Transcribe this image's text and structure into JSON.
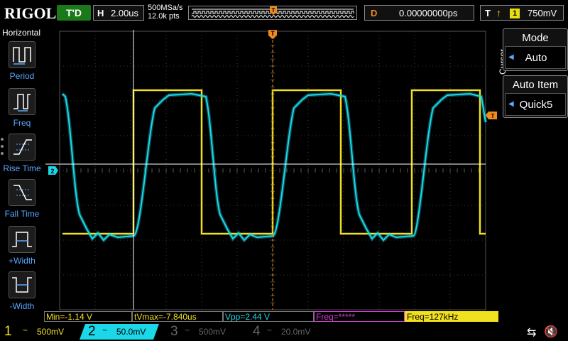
{
  "header": {
    "brand": "RIGOL",
    "run_status": "T'D",
    "horizontal_label": "H",
    "timebase": "2.00us",
    "sample_rate": "500MSa/s",
    "memory_depth": "12.0k pts",
    "trigger_pos_marker": "T",
    "delay_label": "D",
    "delay_value": "0.00000000ps",
    "trigger_label": "T",
    "trigger_source": "1",
    "trigger_level": "750mV"
  },
  "left_menu": {
    "title": "Horizontal",
    "items": [
      {
        "label": "Period",
        "icon": "period-icon"
      },
      {
        "label": "Freq",
        "icon": "frequency-icon"
      },
      {
        "label": "Rise Time",
        "icon": "rise-time-icon"
      },
      {
        "label": "Fall Time",
        "icon": "fall-time-icon"
      },
      {
        "label": "+Width",
        "icon": "positive-width-icon"
      },
      {
        "label": "-Width",
        "icon": "negative-width-icon"
      }
    ]
  },
  "right_menu": {
    "section_label": "Cursor",
    "mode": {
      "title": "Mode",
      "value": "Auto"
    },
    "auto_item": {
      "title": "Auto Item",
      "value": "Quick5"
    }
  },
  "measurements": {
    "min": "Min=-1.14 V",
    "tvmax": "tVmax=-7.840us",
    "vpp": "Vpp=2.44 V",
    "freq_invalid": "Freq=*****",
    "freq": "Freq=127kHz"
  },
  "channels": [
    {
      "num": "1",
      "coupling": "~",
      "scale": "500mV",
      "color": "#f0e020",
      "active": false
    },
    {
      "num": "2",
      "coupling": "~",
      "scale": "50.0mV",
      "color": "#1ad8e8",
      "active": true
    },
    {
      "num": "3",
      "coupling": "~",
      "scale": "500mV",
      "color": "#666666",
      "active": false
    },
    {
      "num": "4",
      "coupling": "~",
      "scale": "20.0mV",
      "color": "#666666",
      "active": false
    }
  ],
  "markers": {
    "ch2_ground": "2",
    "trigger_top": "T",
    "trigger_level_right": "T"
  },
  "icons": {
    "usb": "usb-icon",
    "speaker": "speaker-muted-icon"
  },
  "colors": {
    "ch1": "#f0e020",
    "ch2": "#1ad8e8",
    "trigger": "#f08a1a",
    "accent_blue": "#5aa8ff",
    "run_status_bg": "#1a7a1a"
  }
}
